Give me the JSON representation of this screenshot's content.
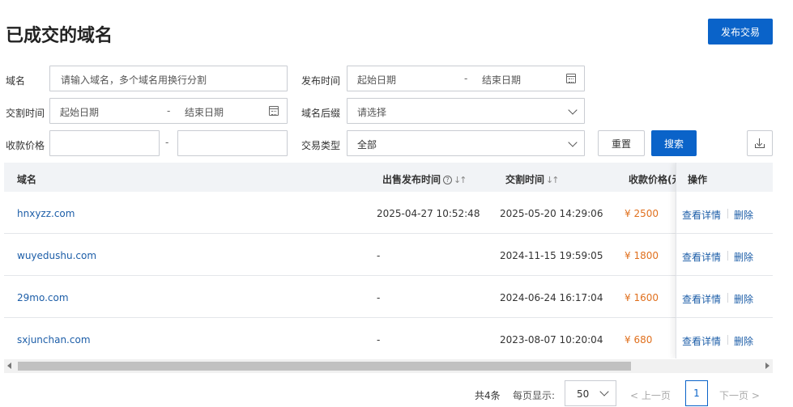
{
  "page": {
    "title": "已成交的域名",
    "publish_button": "发布交易"
  },
  "filters": {
    "domain": {
      "label": "域名",
      "placeholder": "请输入域名，多个域名用换行分割"
    },
    "publish_time": {
      "label": "发布时间",
      "start_placeholder": "起始日期",
      "end_placeholder": "结束日期",
      "separator": "-"
    },
    "deal_time": {
      "label": "交割时间",
      "start_placeholder": "起始日期",
      "end_placeholder": "结束日期",
      "separator": "-"
    },
    "suffix": {
      "label": "域名后缀",
      "placeholder": "请选择"
    },
    "price": {
      "label": "收款价格",
      "separator": "-"
    },
    "trade_type": {
      "label": "交易类型",
      "value": "全部"
    },
    "reset_button": "重置",
    "search_button": "搜索",
    "download_icon": "download-icon"
  },
  "table": {
    "columns": {
      "domain": "域名",
      "publish_time": "出售发布时间",
      "deal_time": "交割时间",
      "price": "收款价格(元",
      "ops": "操作"
    },
    "rows": [
      {
        "domain": "hnxyzz.com",
        "publish_time": "2025-04-27 10:52:48",
        "deal_time": "2025-05-20 14:29:06",
        "price": "¥ 2500",
        "view": "查看详情",
        "delete": "删除"
      },
      {
        "domain": "wuyedushu.com",
        "publish_time": "-",
        "deal_time": "2024-11-15 19:59:05",
        "price": "¥ 1800",
        "view": "查看详情",
        "delete": "删除"
      },
      {
        "domain": "29mo.com",
        "publish_time": "-",
        "deal_time": "2024-06-24 16:17:04",
        "price": "¥ 1600",
        "view": "查看详情",
        "delete": "删除"
      },
      {
        "domain": "sxjunchan.com",
        "publish_time": "-",
        "deal_time": "2023-08-07 10:20:04",
        "price": "¥ 680",
        "view": "查看详情",
        "delete": "删除"
      }
    ]
  },
  "pagination": {
    "total": "共4条",
    "page_size_label": "每页显示:",
    "page_size": "50",
    "prev": "上一页",
    "current_page": "1",
    "next": "下一页"
  },
  "colors": {
    "primary": "#0a63c9",
    "link": "#1d5ea8",
    "price": "#e0701e"
  }
}
